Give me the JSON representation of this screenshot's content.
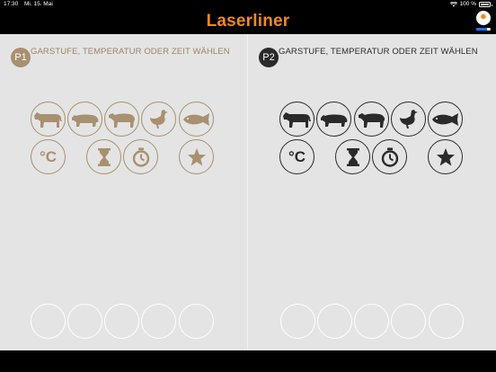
{
  "status": {
    "time": "17:30",
    "date": "Mi. 15. Mai",
    "battery": "100 %"
  },
  "header": {
    "logo": "Laserliner",
    "settings_icon": "sun-icon",
    "progress_fraction": 0.75,
    "progress_color": "#1e6fff"
  },
  "panels": [
    {
      "badge": "P1",
      "title": "GARSTUFE, TEMPERATUR ODER ZEIT WÄHLEN",
      "accent": "#a89070"
    },
    {
      "badge": "P2",
      "title": "GARSTUFE, TEMPERATUR ODER ZEIT WÄHLEN",
      "accent": "#2a2a2a"
    }
  ],
  "categories": [
    "beef-icon",
    "pork-icon",
    "lamb-icon",
    "poultry-icon",
    "fish-icon"
  ],
  "modes": {
    "temperature": "°C",
    "timer": "hourglass-icon",
    "stopwatch": "stopwatch-icon",
    "favorite": "star-icon"
  },
  "slot_count": 5
}
